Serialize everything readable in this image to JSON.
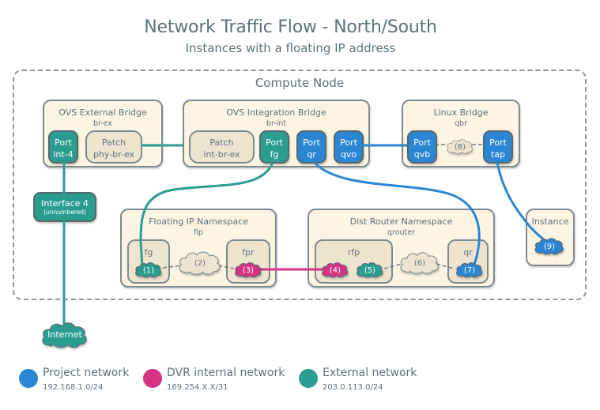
{
  "header": {
    "title": "Network Traffic Flow - North/South",
    "subtitle": "Instances with a floating IP address"
  },
  "compute_node": {
    "label": "Compute Node"
  },
  "colors": {
    "project": "#2a86d2",
    "dvr": "#d63384",
    "external": "#2a9d8f",
    "box_fill": "#fbf4e2",
    "inner_fill": "#ede4d0",
    "border": "#7d8b8f",
    "text": "#5f7179"
  },
  "bridges": {
    "external": {
      "title": "OVS External Bridge",
      "name": "br-ex",
      "port": {
        "line1": "Port",
        "line2": "int-4"
      },
      "patch": {
        "line1": "Patch",
        "line2": "phy-br-ex"
      }
    },
    "integration": {
      "title": "OVS Integration Bridge",
      "name": "br-int",
      "patch": {
        "line1": "Patch",
        "line2": "int-br-ex"
      },
      "ports": [
        {
          "line1": "Port",
          "line2": "fg",
          "network": "external"
        },
        {
          "line1": "Port",
          "line2": "qr",
          "network": "project"
        },
        {
          "line1": "Port",
          "line2": "qvo",
          "network": "project"
        }
      ]
    },
    "linux": {
      "title": "Linux Bridge",
      "name": "qbr",
      "ports": [
        {
          "line1": "Port",
          "line2": "qvb"
        },
        {
          "line1": "Port",
          "line2": "tap"
        }
      ],
      "cloud": "(8)"
    }
  },
  "interface": {
    "name": "Interface 4",
    "note": "(unnumbered)"
  },
  "namespaces": {
    "fip": {
      "title": "Floating IP Namespace",
      "name": "fip",
      "fg_label": "fg",
      "fpr_label": "fpr",
      "clouds": [
        "(1)",
        "(2)",
        "(3)"
      ]
    },
    "qrouter": {
      "title": "Dist Router Namespace",
      "name": "qrouter",
      "rfp_label": "rfp",
      "qr_label": "qr",
      "clouds": [
        "(4)",
        "(5)",
        "(6)",
        "(7)"
      ]
    }
  },
  "instance": {
    "title": "Instance",
    "cloud": "(9)"
  },
  "internet": {
    "label": "Internet"
  },
  "legend": [
    {
      "name": "Project network",
      "network": "192.168.1.0/24",
      "color": "#2a86d2"
    },
    {
      "name": "DVR internal network",
      "network": "169.254.X.X/31",
      "color": "#d63384"
    },
    {
      "name": "External network",
      "network": "203.0.113.0/24",
      "color": "#2a9d8f"
    }
  ]
}
